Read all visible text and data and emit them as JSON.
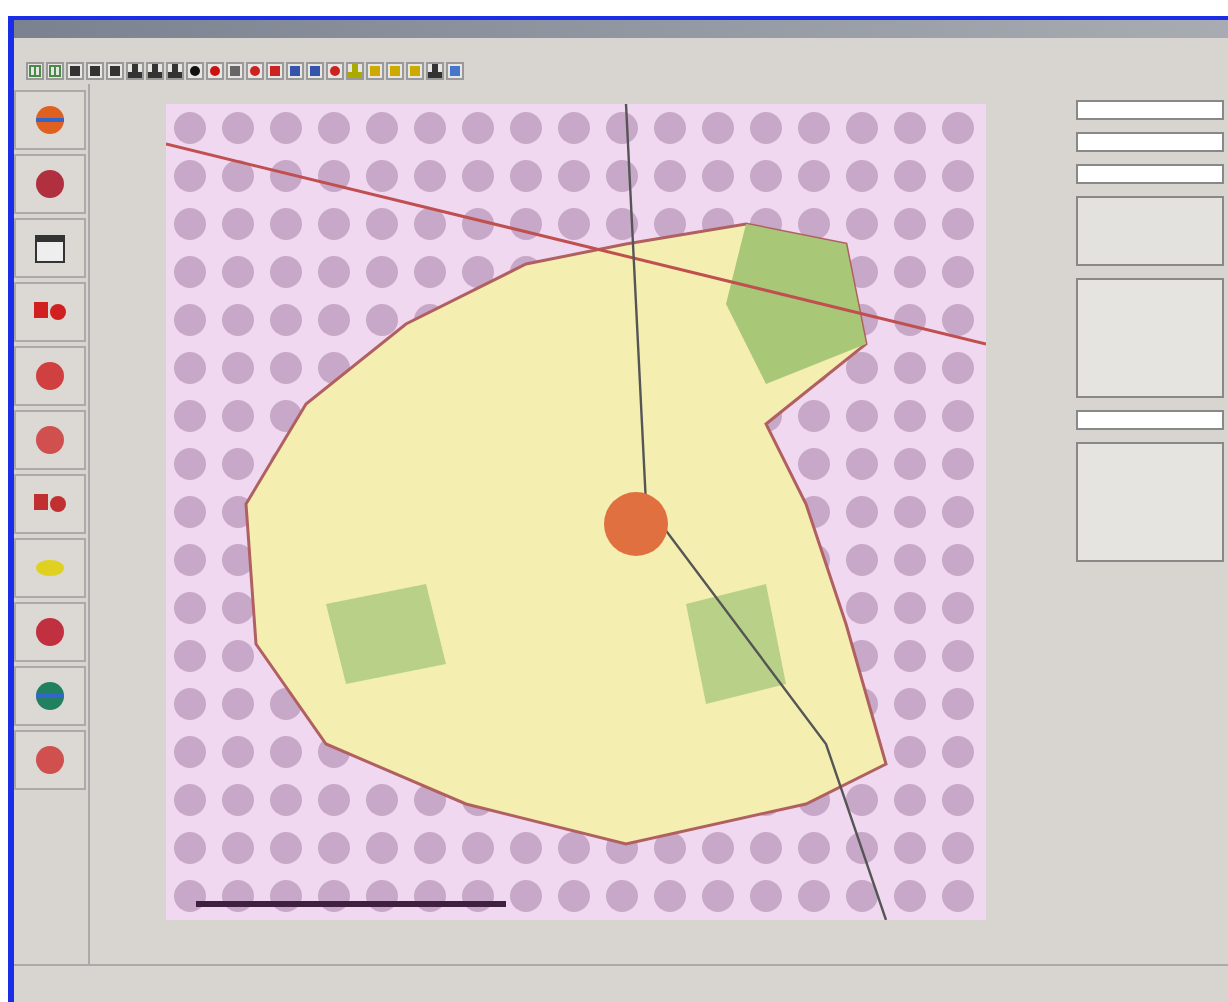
{
  "toolbar": {
    "buttons": [
      {
        "kind": "grid",
        "color": "#4a8a4a"
      },
      {
        "kind": "grid",
        "color": "#4a8a4a"
      },
      {
        "kind": "square",
        "color": "#333333"
      },
      {
        "kind": "square",
        "color": "#333333"
      },
      {
        "kind": "square",
        "color": "#333333"
      },
      {
        "kind": "glyph",
        "color": "#333333"
      },
      {
        "kind": "glyph",
        "color": "#333333"
      },
      {
        "kind": "glyph",
        "color": "#333333"
      },
      {
        "kind": "dot",
        "color": "#111111"
      },
      {
        "kind": "dot",
        "color": "#cc1111"
      },
      {
        "kind": "square",
        "color": "#666666"
      },
      {
        "kind": "dot",
        "color": "#cc2222"
      },
      {
        "kind": "square",
        "color": "#cc2222"
      },
      {
        "kind": "square",
        "color": "#3355aa"
      },
      {
        "kind": "square",
        "color": "#3355aa"
      },
      {
        "kind": "dot",
        "color": "#cc2222"
      },
      {
        "kind": "glyph",
        "color": "#aaaa00"
      },
      {
        "kind": "square",
        "color": "#ccaa00"
      },
      {
        "kind": "square",
        "color": "#ccaa00"
      },
      {
        "kind": "square",
        "color": "#ccaa00"
      },
      {
        "kind": "glyph",
        "color": "#333333"
      },
      {
        "kind": "square",
        "color": "#4477cc"
      }
    ]
  },
  "sidebar": {
    "buttons": [
      {
        "kind": "globe",
        "color": "#e06020"
      },
      {
        "kind": "dot",
        "color": "#b03040"
      },
      {
        "kind": "calendar",
        "color": "#333333"
      },
      {
        "kind": "pair",
        "color": "#d02020"
      },
      {
        "kind": "dot",
        "color": "#d04040"
      },
      {
        "kind": "dot",
        "color": "#d05050"
      },
      {
        "kind": "pair",
        "color": "#c03030"
      },
      {
        "kind": "oval",
        "color": "#e0d020"
      },
      {
        "kind": "dot",
        "color": "#c03040"
      },
      {
        "kind": "globe",
        "color": "#208060"
      },
      {
        "kind": "dot",
        "color": "#d05050"
      }
    ]
  },
  "right_panel": {
    "items": [
      {
        "kind": "dropdown"
      },
      {
        "kind": "field"
      },
      {
        "kind": "field"
      },
      {
        "kind": "memo"
      },
      {
        "kind": "list"
      },
      {
        "kind": "dropdown"
      },
      {
        "kind": "list"
      }
    ]
  }
}
